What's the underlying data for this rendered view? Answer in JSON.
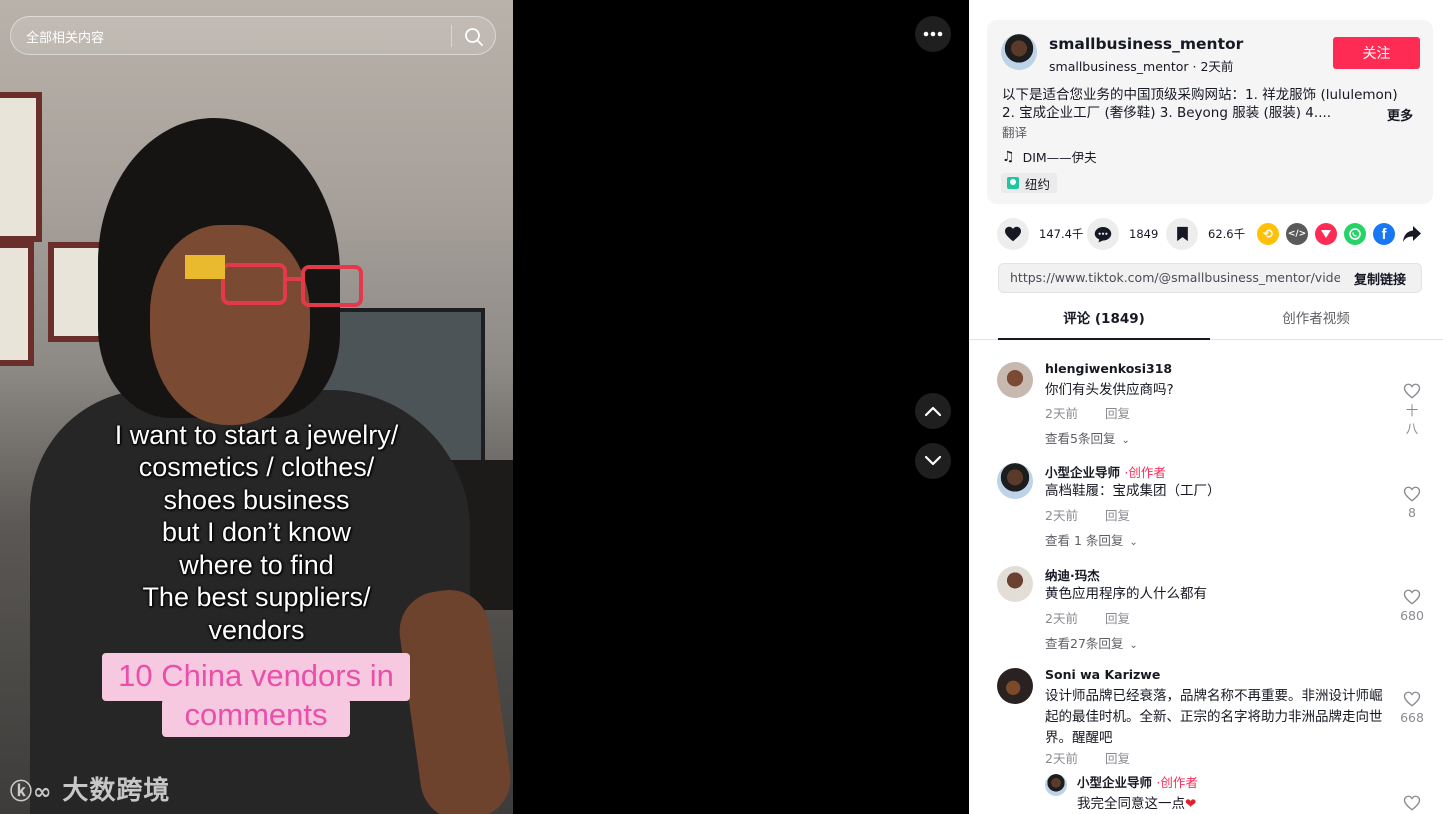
{
  "search": {
    "placeholder": "全部相关内容"
  },
  "video": {
    "overlay_lines": [
      "I want to start a jewelry/",
      "cosmetics / clothes/",
      "shoes business",
      "but I don’t know",
      "where to find",
      "The best suppliers/",
      "vendors"
    ],
    "pink_line1": "10 China vendors in",
    "pink_line2": "comments",
    "watermark": "大数跨境"
  },
  "author": {
    "username": "smallbusiness_mentor",
    "handle": "smallbusiness_mentor",
    "date": "2天前",
    "follow_label": "关注",
    "description_line1": "以下是适合您业务的中国顶级采购网站：1. 祥龙服饰 (lululemon)",
    "description_line2": "2. 宝成企业工厂 (奢侈鞋) 3. Beyong 服装 (服装) 4....",
    "more_label": "更多",
    "translate_label": "翻译",
    "music": "DIM——伊夫",
    "location": "纽约"
  },
  "actions": {
    "likes": "147.4千",
    "comments": "1849",
    "saves": "62.6千"
  },
  "link": {
    "url": "https://www.tiktok.com/@smallbusiness_mentor/video/...",
    "copy_label": "复制链接"
  },
  "tabs": [
    {
      "label": "评论 (1849)"
    },
    {
      "label": "创作者视频"
    }
  ],
  "comments": [
    {
      "user": "hlengiwenkosi318",
      "creator_tag": "",
      "text": "你们有头发供应商吗?",
      "time": "2天前",
      "reply": "回复",
      "view_replies": "查看5条回复",
      "likes": "十\n八"
    },
    {
      "user": "小型企业导师",
      "creator_tag": "·创作者",
      "text": "高档鞋履：宝成集团（工厂）",
      "time": "2天前",
      "reply": "回复",
      "view_replies": "查看 1 条回复",
      "likes": "8"
    },
    {
      "user": "纳迪·玛杰",
      "creator_tag": "",
      "text": "黄色应用程序的人什么都有",
      "time": "2天前",
      "reply": "回复",
      "view_replies": "查看27条回复",
      "likes": "680"
    },
    {
      "user": "Soni wa Karizwe",
      "creator_tag": "",
      "text": "设计师品牌已经衰落，品牌名称不再重要。非洲设计师崛起的最佳时机。全新、正宗的名字将助力非洲品牌走向世界。醒醒吧",
      "time": "2天前",
      "reply": "回复",
      "view_replies": "",
      "likes": "668"
    }
  ],
  "reply": {
    "user": "小型企业导师",
    "creator_tag": "·创作者",
    "text": "我完全同意这一点"
  },
  "colors": {
    "accent": "#fe2c55",
    "text": "#161823",
    "muted": "#8a8b91"
  }
}
